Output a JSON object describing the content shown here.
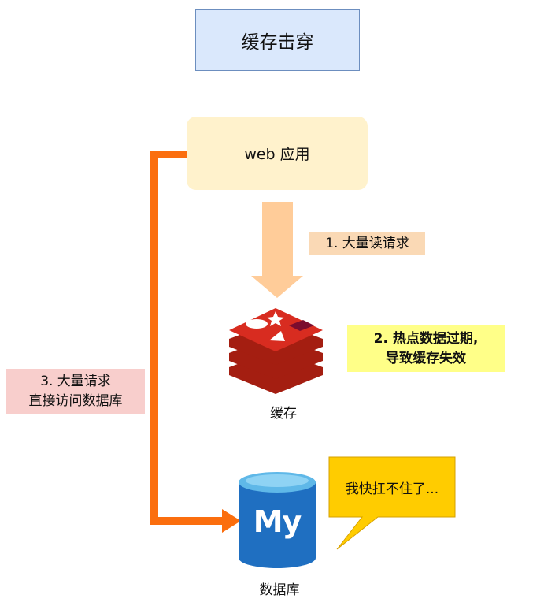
{
  "title": "缓存击穿",
  "web_app": "web 应用",
  "step1": "1. 大量读请求",
  "step2": [
    "2. 热点数据过期,",
    "导致缓存失效"
  ],
  "step3": [
    "3. 大量请求",
    "直接访问数据库"
  ],
  "cache_label": "缓存",
  "db_label": "数据库",
  "db_logo_text": "My",
  "bubble_text": "我快扛不住了...",
  "colors": {
    "orange_line": "#fb6e0e",
    "arrow_fill": "#ffcc99",
    "redis_red": "#c92f2b",
    "db_blue": "#1f6fc1",
    "bubble": "#ffcc00"
  }
}
